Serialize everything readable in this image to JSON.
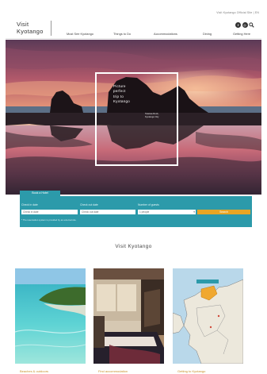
{
  "header": {
    "top_link": "Visit Kyotango Official Site | EN",
    "logo_line1": "Visit",
    "logo_line2": "Kyotango",
    "nav": [
      "Must See Kyotango",
      "Things to Do",
      "Accommodations",
      "Dining",
      "Getting Here"
    ],
    "social": {
      "facebook": "f",
      "instagram": "◎"
    },
    "icons": {
      "facebook": "facebook-icon",
      "instagram": "instagram-icon",
      "search": "search-icon"
    }
  },
  "hero": {
    "frame_lines": [
      "Picture",
      "perfect",
      "trip to",
      "Kyotango"
    ],
    "frame_small": [
      "Tateiwa Rock,",
      "Kyotango City"
    ]
  },
  "search": {
    "tab_label": "Book a Hotel",
    "labels": {
      "checkin": "Check in date",
      "checkout": "Check out date",
      "people": "Number of guests"
    },
    "values": {
      "checkin": "Check in date",
      "checkout": "Check out date",
      "people": "1 people"
    },
    "button": "Search",
    "note": "* The reservation system is provided by an external site."
  },
  "section": {
    "title": "Visit Kyotango"
  },
  "cards": [
    {
      "caption": "Beaches & outdoors"
    },
    {
      "caption": "Find accommodation"
    },
    {
      "caption": "Getting to Kyotango"
    }
  ],
  "colors": {
    "teal": "#2c9aaa",
    "orange": "#e8a525",
    "caption": "#c8902a"
  }
}
